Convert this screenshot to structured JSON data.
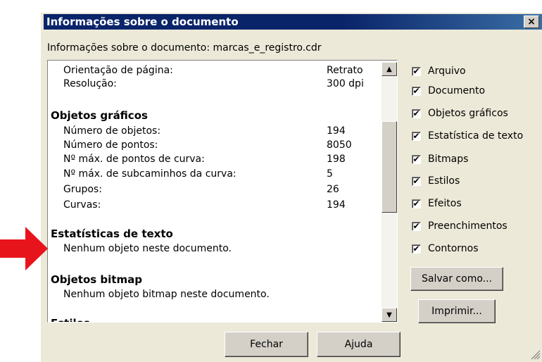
{
  "dialog": {
    "title": "Informações sobre o documento",
    "close_label": "×",
    "subtitle": "Informações sobre o documento: marcas_e_registro.cdr"
  },
  "list": {
    "page": [
      {
        "label": "Orientação de página:",
        "value": "Retrato"
      },
      {
        "label": "Resolução:",
        "value": "300 dpi"
      }
    ],
    "graphics": {
      "heading": "Objetos gráficos",
      "rows": [
        {
          "label": "Número de objetos:",
          "value": "194"
        },
        {
          "label": "Número de pontos:",
          "value": "8050"
        },
        {
          "label": "Nº máx. de pontos de curva:",
          "value": "198"
        },
        {
          "label": "Nº máx. de subcaminhos da curva:",
          "value": "5"
        },
        {
          "label": "Grupos:",
          "value": "26"
        },
        {
          "label": "Curvas:",
          "value": "194"
        }
      ]
    },
    "text_stats": {
      "heading": "Estatísticas de texto",
      "note": "Nenhum objeto neste documento."
    },
    "bitmap": {
      "heading": "Objetos bitmap",
      "note": "Nenhum objeto bitmap neste documento."
    },
    "cutoff_heading": "Estilos"
  },
  "checkboxes": [
    {
      "label": "Arquivo",
      "checked": true
    },
    {
      "label": "Documento",
      "checked": true
    },
    {
      "label": "Objetos gráficos",
      "checked": true
    },
    {
      "label": "Estatística de texto",
      "checked": true
    },
    {
      "label": "Bitmaps",
      "checked": true
    },
    {
      "label": "Estilos",
      "checked": true
    },
    {
      "label": "Efeitos",
      "checked": true
    },
    {
      "label": "Preenchimentos",
      "checked": true
    },
    {
      "label": "Contornos",
      "checked": true
    }
  ],
  "check_mark": "✔",
  "buttons": {
    "save_as": "Salvar como...",
    "print": "Imprimir...",
    "close": "Fechar",
    "help": "Ajuda"
  },
  "scroll": {
    "up_icon": "▲",
    "down_icon": "▼"
  },
  "colors": {
    "titlebar": "#0a246a",
    "face": "#ece9d8",
    "arrow": "#e8141c"
  }
}
